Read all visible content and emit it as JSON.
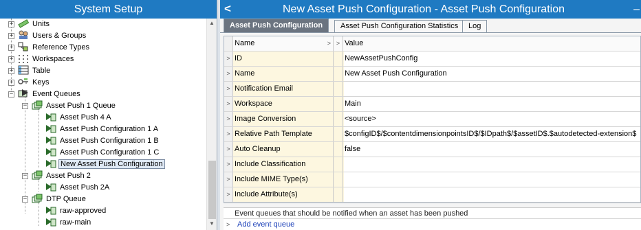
{
  "left_panel": {
    "title": "System Setup",
    "tree": [
      {
        "label": "Units",
        "icon": "ruler-icon",
        "expander": "+"
      },
      {
        "label": "Users & Groups",
        "icon": "users-icon",
        "expander": "+"
      },
      {
        "label": "Reference Types",
        "icon": "reference-types-icon",
        "expander": "+"
      },
      {
        "label": "Workspaces",
        "icon": "workspaces-icon",
        "expander": "+"
      },
      {
        "label": "Table",
        "icon": "table-icon",
        "expander": "+"
      },
      {
        "label": "Keys",
        "icon": "keys-icon",
        "expander": "+"
      },
      {
        "label": "Event Queues",
        "icon": "event-queues-icon",
        "expander": "−"
      },
      {
        "label": "Asset Push 1 Queue",
        "icon": "queue-icon",
        "expander": "−"
      },
      {
        "label": "Asset Push 4 A",
        "icon": "push-config-icon"
      },
      {
        "label": "Asset Push Configuration 1 A",
        "icon": "push-config-icon"
      },
      {
        "label": "Asset Push Configuration 1 B",
        "icon": "push-config-icon"
      },
      {
        "label": "Asset Push Configuration 1 C",
        "icon": "push-config-icon"
      },
      {
        "label": "New Asset Push Configuration",
        "icon": "push-config-icon",
        "selected": true
      },
      {
        "label": "Asset Push 2",
        "icon": "queue-icon",
        "expander": "−"
      },
      {
        "label": "Asset Push 2A",
        "icon": "push-config-icon"
      },
      {
        "label": "DTP Queue",
        "icon": "queue-icon",
        "expander": "−"
      },
      {
        "label": "raw-approved",
        "icon": "push-config-icon"
      },
      {
        "label": "raw-main",
        "icon": "push-config-icon"
      }
    ]
  },
  "right_panel": {
    "back_glyph": "<",
    "title": "New Asset Push Configuration - Asset Push Configuration",
    "minimize_glyph": "–",
    "tabs": [
      {
        "label": "Asset Push Configuration",
        "active": true
      },
      {
        "label": "Asset Push Configuration Statistics",
        "active": false
      },
      {
        "label": "Log",
        "active": false
      }
    ],
    "grid": {
      "col_name": "Name",
      "col_value": "Value",
      "rows": [
        {
          "name": "ID",
          "value": "NewAssetPushConfig"
        },
        {
          "name": "Name",
          "value": "New Asset Push Configuration"
        },
        {
          "name": "Notification Email",
          "value": ""
        },
        {
          "name": "Workspace",
          "value": "Main"
        },
        {
          "name": "Image Conversion",
          "value": "<source>"
        },
        {
          "name": "Relative Path Template",
          "value": "$configID$/$contentdimensionpointsID$/$IDpath$/$assetID$.$autodetected-extension$"
        },
        {
          "name": "Auto Cleanup",
          "value": "false"
        },
        {
          "name": "Include Classification",
          "value": ""
        },
        {
          "name": "Include MIME Type(s)",
          "value": ""
        },
        {
          "name": "Include Attribute(s)",
          "value": ""
        }
      ]
    },
    "event_section": {
      "description": "Event queues that should be notified when an asset has been pushed",
      "add_link": "Add event queue"
    }
  },
  "colors": {
    "header_blue": "#1f7ac2",
    "active_tab": "#6b7480",
    "row_highlight": "#fdf7e0",
    "link_blue": "#1a3fb8"
  }
}
